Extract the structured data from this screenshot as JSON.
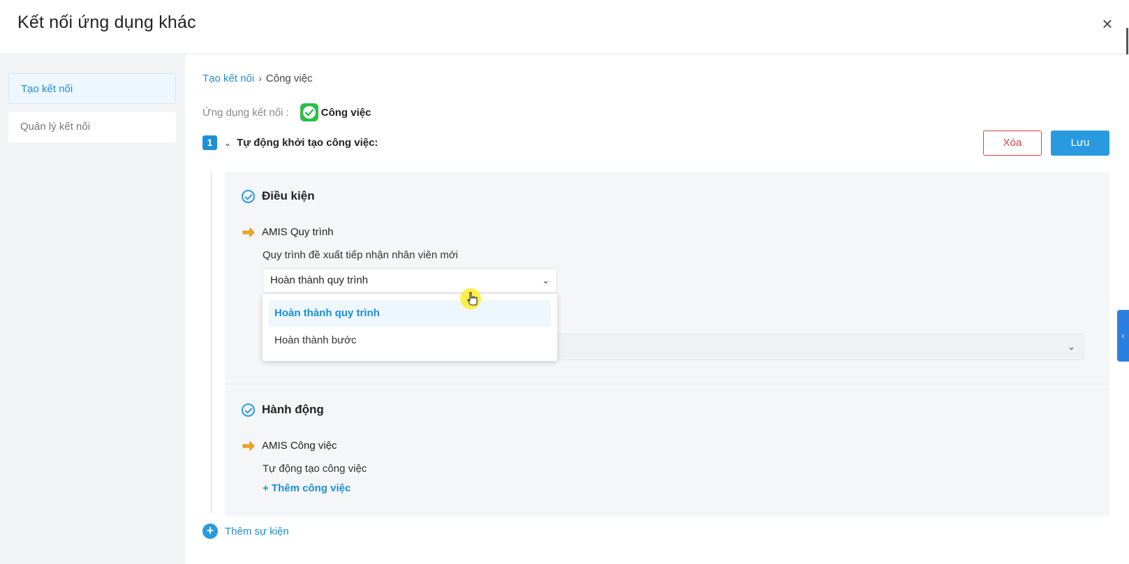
{
  "header": {
    "title": "Kết nối ứng dụng khác",
    "close_icon": "×"
  },
  "sidebar": {
    "items": [
      {
        "label": "Tạo kết nối"
      },
      {
        "label": "Quản lý kết nối"
      }
    ]
  },
  "breadcrumb": {
    "link": "Tạo kết nối",
    "separator": "›",
    "current": "Công việc"
  },
  "app_connect": {
    "label": "Ứng dụng kết nối :",
    "app_name": "Công việc"
  },
  "step": {
    "number": "1",
    "chevron": "⌄",
    "title": "Tự động khởi tạo công việc:"
  },
  "buttons": {
    "delete": "Xóa",
    "save": "Lưu"
  },
  "condition": {
    "heading": "Điều kiện",
    "app": "AMIS Quy trình",
    "process": "Quy trình đề xuất tiếp nhận nhân viên mới",
    "select_value": "Hoàn thành quy trình",
    "caret": "⌄",
    "options": [
      "Hoàn thành quy trình",
      "Hoàn thành bước"
    ]
  },
  "action": {
    "heading": "Hành động",
    "app": "AMIS Công việc",
    "desc": "Tự động tạo công việc",
    "add_task": "+ Thêm công việc"
  },
  "add_event": {
    "plus": "+",
    "label": "Thêm sự kiện"
  },
  "side_toggle": {
    "icon": "‹"
  },
  "colors": {
    "accent": "#2a9ae0",
    "danger": "#d94040",
    "app_green": "#2bbf4a",
    "arrow_orange": "#f5a623"
  }
}
